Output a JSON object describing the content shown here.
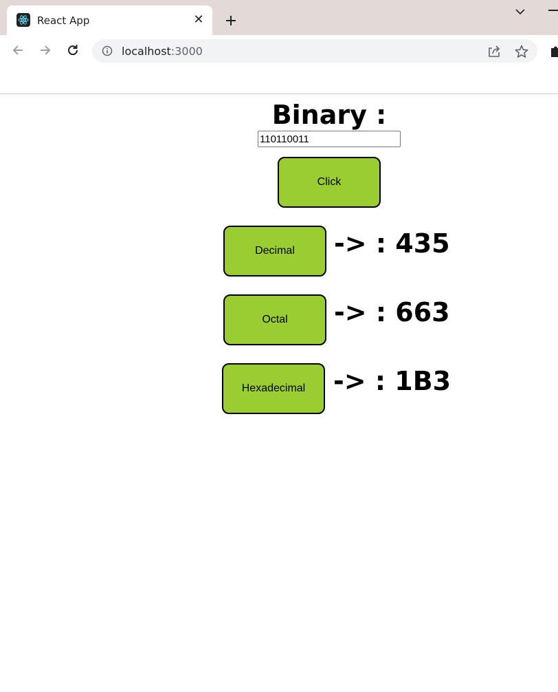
{
  "browser": {
    "tab_title": "React App",
    "tab_close": "✕",
    "new_tab": "+",
    "url_host": "localhost",
    "url_port": ":3000"
  },
  "page": {
    "heading": "Binary :",
    "binary_value": "110110011",
    "click_label": "Click",
    "conversions": [
      {
        "label": "Decimal",
        "result": "-> : 435"
      },
      {
        "label": "Octal",
        "result": "-> : 663"
      },
      {
        "label": "Hexadecimal",
        "result": "-> : 1B3"
      }
    ]
  },
  "colors": {
    "button_bg": "#9acd32",
    "tabstrip_bg": "#e3dad7",
    "omnibox_bg": "#f1f3f4"
  },
  "icons": [
    "react-favicon-icon",
    "close-icon",
    "plus-icon",
    "chevron-down-icon",
    "minimize-icon",
    "back-arrow-icon",
    "forward-arrow-icon",
    "reload-icon",
    "info-icon",
    "share-icon",
    "star-icon",
    "puzzle-extension-icon"
  ]
}
